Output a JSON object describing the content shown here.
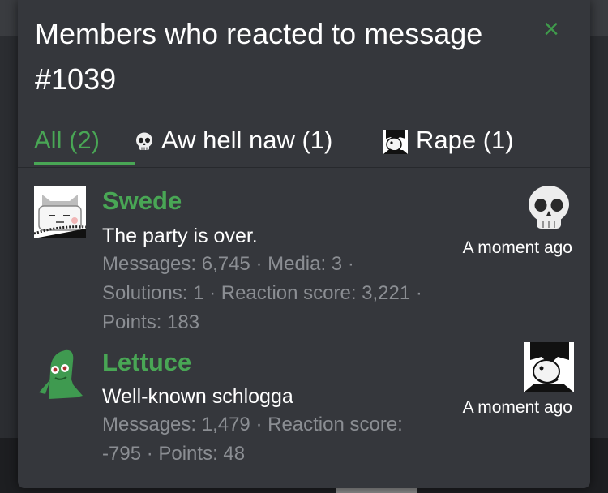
{
  "modal": {
    "title": "Members who reacted to message #1039",
    "close_icon": "×"
  },
  "tabs": [
    {
      "label": "All (2)",
      "icon": null
    },
    {
      "label": "Aw hell naw (1)",
      "icon": "skull-icon"
    },
    {
      "label": "Rape (1)",
      "icon": "cartoon-face-icon"
    }
  ],
  "members": [
    {
      "name": "Swede",
      "user_title": "The party is over.",
      "stats": "Messages: 6,745 · Media: 3 · Solutions: 1 · Reaction score: 3,221 · Points: 183",
      "reaction_icon": "skull-icon",
      "time": "A moment ago",
      "avatar": "cat-face-avatar"
    },
    {
      "name": "Lettuce",
      "user_title": "Well-known schlogga",
      "stats": "Messages: 1,479 · Reaction score: -795 · Points: 48",
      "reaction_icon": "cartoon-face-icon",
      "time": "A moment ago",
      "avatar": "green-clay-figure-avatar"
    }
  ],
  "colors": {
    "accent": "#49a655",
    "panel": "#35373c",
    "muted_text": "#8b8e93"
  }
}
